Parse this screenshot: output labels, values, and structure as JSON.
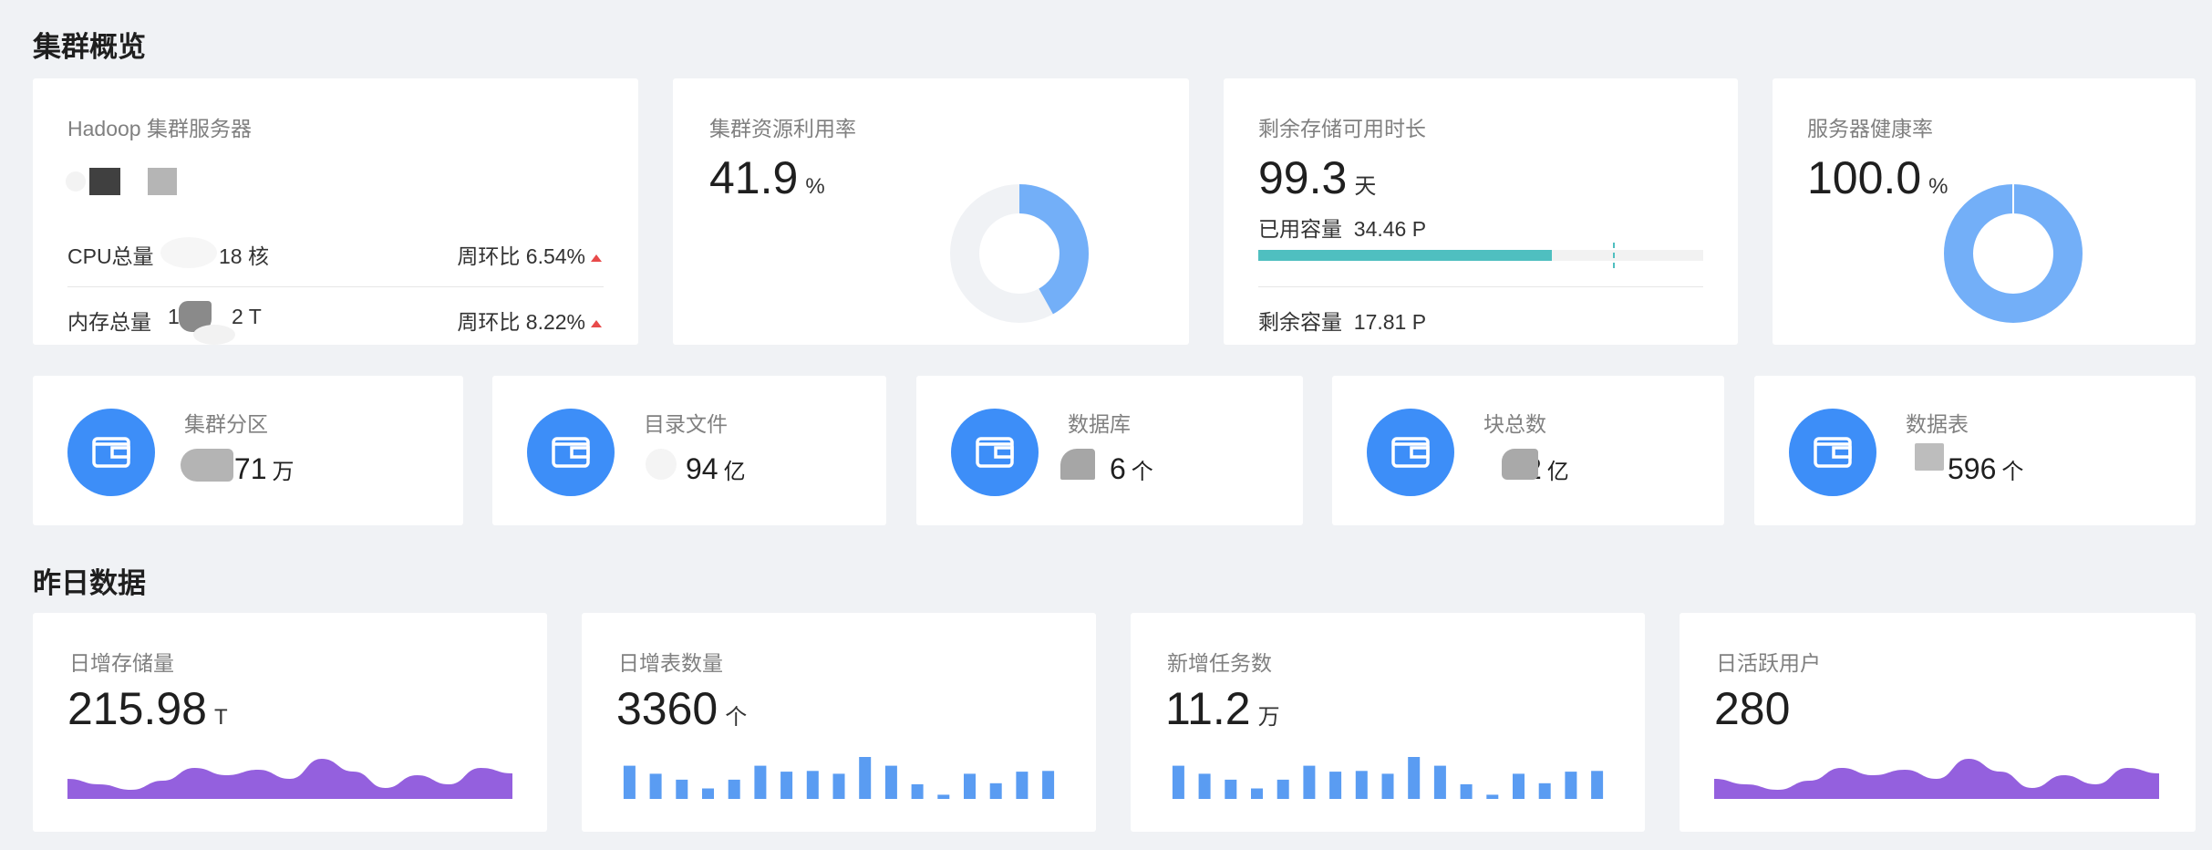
{
  "overview": {
    "title": "集群概览",
    "hadoop": {
      "label": "Hadoop 集群服务器",
      "cpu_label": "CPU总量",
      "cpu_value": "18 核",
      "cpu_compare": "周环比 6.54%",
      "mem_label": "内存总量",
      "mem_value_a": "1",
      "mem_value_b": "2 T",
      "mem_compare": "周环比 8.22%"
    },
    "utilization": {
      "label": "集群资源利用率",
      "value": "41.9",
      "unit": "%",
      "fraction": 0.419,
      "color": "#73aff8"
    },
    "storage": {
      "label": "剩余存储可用时长",
      "value": "99.3",
      "unit": "天",
      "used_label": "已用容量",
      "used_value": "34.46 P",
      "remain_label": "剩余容量",
      "remain_value": "17.81 P",
      "bar_fill": 0.66,
      "bar_color": "#4fbfc0"
    },
    "health": {
      "label": "服务器健康率",
      "value": "100.0",
      "unit": "%",
      "fraction": 1.0,
      "color": "#73aff8"
    }
  },
  "stats": [
    {
      "label": "集群分区",
      "value": ".71",
      "unit": "万",
      "icon": "wallet-icon"
    },
    {
      "label": "目录文件",
      "value": "94",
      "unit": "亿",
      "icon": "wallet-icon"
    },
    {
      "label": "数据库",
      "value": "6",
      "unit": "个",
      "icon": "wallet-icon"
    },
    {
      "label": "块总数",
      "value": "2",
      "unit": "亿",
      "icon": "wallet-icon"
    },
    {
      "label": "数据表",
      "value": "596",
      "unit": "个",
      "icon": "wallet-icon"
    }
  ],
  "yesterday": {
    "title": "昨日数据",
    "cards": [
      {
        "label": "日增存储量",
        "value": "215.98",
        "unit": "T",
        "chart": "area"
      },
      {
        "label": "日增表数量",
        "value": "3360",
        "unit": "个",
        "chart": "bar"
      },
      {
        "label": "新增任务数",
        "value": "11.2",
        "unit": "万",
        "chart": "bar"
      },
      {
        "label": "日活跃用户",
        "value": "280",
        "unit": "",
        "chart": "area"
      }
    ],
    "bar_series": [
      0.95,
      0.72,
      0.55,
      0.3,
      0.55,
      0.95,
      0.78,
      0.8,
      0.72,
      1.2,
      0.95,
      0.42,
      0.12,
      0.72,
      0.45,
      0.78,
      0.8
    ],
    "area_series": [
      0.5,
      0.35,
      0.2,
      0.45,
      0.8,
      0.6,
      0.75,
      0.5,
      1.05,
      0.7,
      0.25,
      0.6,
      0.35,
      0.8,
      0.65
    ],
    "bar_color": "#5a9cf2",
    "area_color": "#9460de"
  }
}
